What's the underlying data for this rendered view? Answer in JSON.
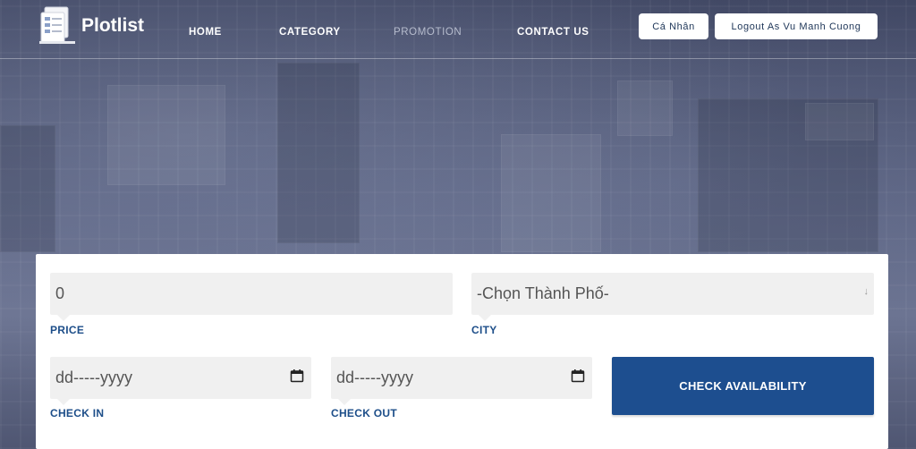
{
  "brand": "Plotlist",
  "nav": [
    "HOME",
    "CATEGORY",
    "PROMOTION",
    "CONTACT US"
  ],
  "header_buttons": {
    "profile": "Cá Nhân",
    "logout": "Logout As Vu Manh Cuong"
  },
  "form": {
    "price_value": "0",
    "price_label": "PRICE",
    "city_value": "-Chọn Thành Phố-",
    "city_label": "CITY",
    "checkin_value": "dd-----yyyy",
    "checkin_label": "CHECK IN",
    "checkout_value": "dd-----yyyy",
    "checkout_label": "CHECK OUT",
    "submit_label": "CHECK AVAILABILITY"
  },
  "colors": {
    "accent": "#1d4e8f",
    "label": "#1d4e89"
  },
  "icons": [
    "logo-icon",
    "calendar-icon",
    "chevron-down-icon"
  ]
}
